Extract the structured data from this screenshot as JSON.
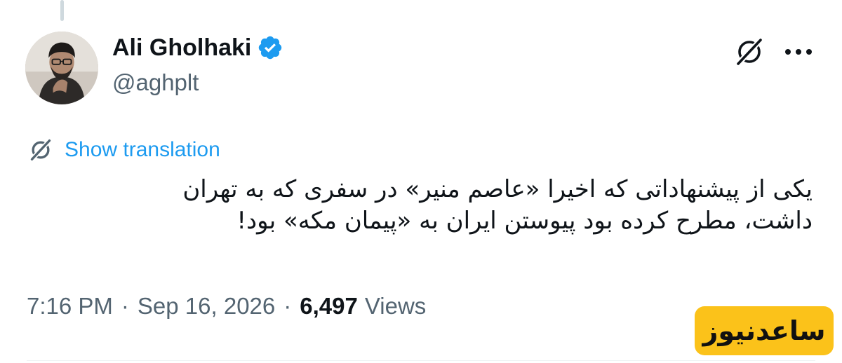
{
  "tweet": {
    "author": {
      "display_name": "Ali Gholhaki",
      "handle": "@aghplt",
      "verified": true,
      "avatar_icon": "profile-photo"
    },
    "actions": {
      "grok_icon": "grok-icon",
      "more_icon": "more-dots-icon"
    },
    "translate": {
      "icon": "grok-icon",
      "label": "Show translation"
    },
    "text_lines": [
      "یکی از پیشنهاداتی که اخیرا «عاصم منیر» در سفری که به تهران",
      "داشت، مطرح کرده بود پیوستن ایران به «پیمان مکه» بود!"
    ],
    "meta": {
      "time": "7:16 PM",
      "separator": "·",
      "date": "Sep 16, 2026",
      "views_count": "6,497",
      "views_label": "Views"
    }
  },
  "watermark": {
    "text": "ساعدنیوز"
  },
  "colors": {
    "link_blue": "#1d9bf0",
    "verified_blue": "#1d9bf0",
    "secondary_text": "#536471",
    "primary_text": "#0f1419",
    "watermark_bg": "#fbc21a"
  }
}
